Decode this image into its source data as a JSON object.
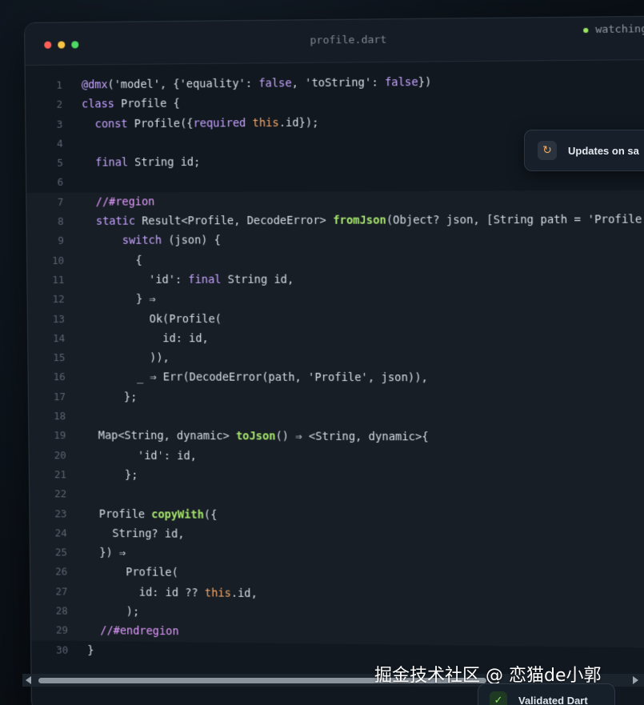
{
  "window": {
    "filename": "profile.dart",
    "status": "watching"
  },
  "toast": {
    "icon": "refresh-icon",
    "text": "Updates on sa"
  },
  "code_lines": [
    {
      "n": "1",
      "region": false,
      "indent": "",
      "tokens": [
        [
          "@dmx",
          "kw"
        ],
        [
          "('model', {'equality': ",
          "txt"
        ],
        [
          "false",
          "kw"
        ],
        [
          ", 'toString': ",
          "txt"
        ],
        [
          "false",
          "kw"
        ],
        [
          "})",
          "txt"
        ]
      ]
    },
    {
      "n": "2",
      "region": false,
      "indent": "",
      "tokens": [
        [
          "class",
          "kw"
        ],
        [
          " Profile {",
          "txt"
        ]
      ]
    },
    {
      "n": "3",
      "region": false,
      "indent": "  ",
      "tokens": [
        [
          "const",
          "kw"
        ],
        [
          " Profile({",
          "txt"
        ],
        [
          "required",
          "kw"
        ],
        [
          " ",
          "txt"
        ],
        [
          "this",
          "th"
        ],
        [
          ".id});",
          "txt"
        ]
      ]
    },
    {
      "n": "4",
      "region": false,
      "indent": "",
      "tokens": []
    },
    {
      "n": "5",
      "region": false,
      "indent": "  ",
      "tokens": [
        [
          "final",
          "kw"
        ],
        [
          " String id;",
          "txt"
        ]
      ]
    },
    {
      "n": "6",
      "region": false,
      "indent": "",
      "tokens": []
    },
    {
      "n": "7",
      "region": true,
      "indent": "  ",
      "tokens": [
        [
          "//#region",
          "cm"
        ]
      ]
    },
    {
      "n": "8",
      "region": true,
      "indent": "  ",
      "tokens": [
        [
          "static",
          "kw"
        ],
        [
          " Result<Profile, DecodeError> ",
          "txt"
        ],
        [
          "fromJson",
          "fn"
        ],
        [
          "(Object? json, [String path = 'Profile']) {",
          "txt"
        ]
      ]
    },
    {
      "n": "9",
      "region": true,
      "indent": "      ",
      "tokens": [
        [
          "switch",
          "kw"
        ],
        [
          " (json) {",
          "txt"
        ]
      ]
    },
    {
      "n": "10",
      "region": true,
      "indent": "        ",
      "tokens": [
        [
          "{",
          "txt"
        ]
      ]
    },
    {
      "n": "11",
      "region": true,
      "indent": "          ",
      "tokens": [
        [
          "'id': ",
          "txt"
        ],
        [
          "final",
          "kw"
        ],
        [
          " String id,",
          "txt"
        ]
      ]
    },
    {
      "n": "12",
      "region": true,
      "indent": "        ",
      "tokens": [
        [
          "} ⇒",
          "txt"
        ]
      ]
    },
    {
      "n": "13",
      "region": true,
      "indent": "          ",
      "tokens": [
        [
          "Ok(Profile(",
          "txt"
        ]
      ]
    },
    {
      "n": "14",
      "region": true,
      "indent": "            ",
      "tokens": [
        [
          "id: id,",
          "txt"
        ]
      ]
    },
    {
      "n": "15",
      "region": true,
      "indent": "          ",
      "tokens": [
        [
          ")),",
          "txt"
        ]
      ]
    },
    {
      "n": "16",
      "region": true,
      "indent": "        ",
      "tokens": [
        [
          "_ ⇒ Err(DecodeError(path, 'Profile', json)),",
          "txt"
        ]
      ]
    },
    {
      "n": "17",
      "region": true,
      "indent": "      ",
      "tokens": [
        [
          "};",
          "txt"
        ]
      ]
    },
    {
      "n": "18",
      "region": true,
      "indent": "",
      "tokens": []
    },
    {
      "n": "19",
      "region": true,
      "indent": "  ",
      "tokens": [
        [
          "Map<String, dynamic> ",
          "txt"
        ],
        [
          "toJson",
          "fn"
        ],
        [
          "() ⇒ <String, dynamic>{",
          "txt"
        ]
      ]
    },
    {
      "n": "20",
      "region": true,
      "indent": "        ",
      "tokens": [
        [
          "'id': id,",
          "txt"
        ]
      ]
    },
    {
      "n": "21",
      "region": true,
      "indent": "      ",
      "tokens": [
        [
          "};",
          "txt"
        ]
      ]
    },
    {
      "n": "22",
      "region": true,
      "indent": "",
      "tokens": []
    },
    {
      "n": "23",
      "region": true,
      "indent": "  ",
      "tokens": [
        [
          "Profile ",
          "txt"
        ],
        [
          "copyWith",
          "fn"
        ],
        [
          "({",
          "txt"
        ]
      ]
    },
    {
      "n": "24",
      "region": true,
      "indent": "    ",
      "tokens": [
        [
          "String? id,",
          "txt"
        ]
      ]
    },
    {
      "n": "25",
      "region": true,
      "indent": "  ",
      "tokens": [
        [
          "}) ⇒",
          "txt"
        ]
      ]
    },
    {
      "n": "26",
      "region": true,
      "indent": "      ",
      "tokens": [
        [
          "Profile(",
          "txt"
        ]
      ]
    },
    {
      "n": "27",
      "region": true,
      "indent": "        ",
      "tokens": [
        [
          "id: id ?? ",
          "txt"
        ],
        [
          "this",
          "th"
        ],
        [
          ".id,",
          "txt"
        ]
      ]
    },
    {
      "n": "28",
      "region": true,
      "indent": "      ",
      "tokens": [
        [
          ");",
          "txt"
        ]
      ]
    },
    {
      "n": "29",
      "region": true,
      "indent": "  ",
      "tokens": [
        [
          "//#endregion",
          "cm"
        ]
      ]
    },
    {
      "n": "30",
      "region": false,
      "indent": "",
      "tokens": [
        [
          "}",
          "txt"
        ]
      ]
    }
  ],
  "watermark": "掘金技术社区 @ 恋猫de小郭",
  "badge": {
    "icon": "check-icon",
    "text": "Validated Dart"
  },
  "colors": {
    "keyword": "#c7a3ff",
    "function": "#a6e36b",
    "this": "#f1a66a",
    "comment": "#e39aff",
    "watching_dot": "#9be564"
  }
}
